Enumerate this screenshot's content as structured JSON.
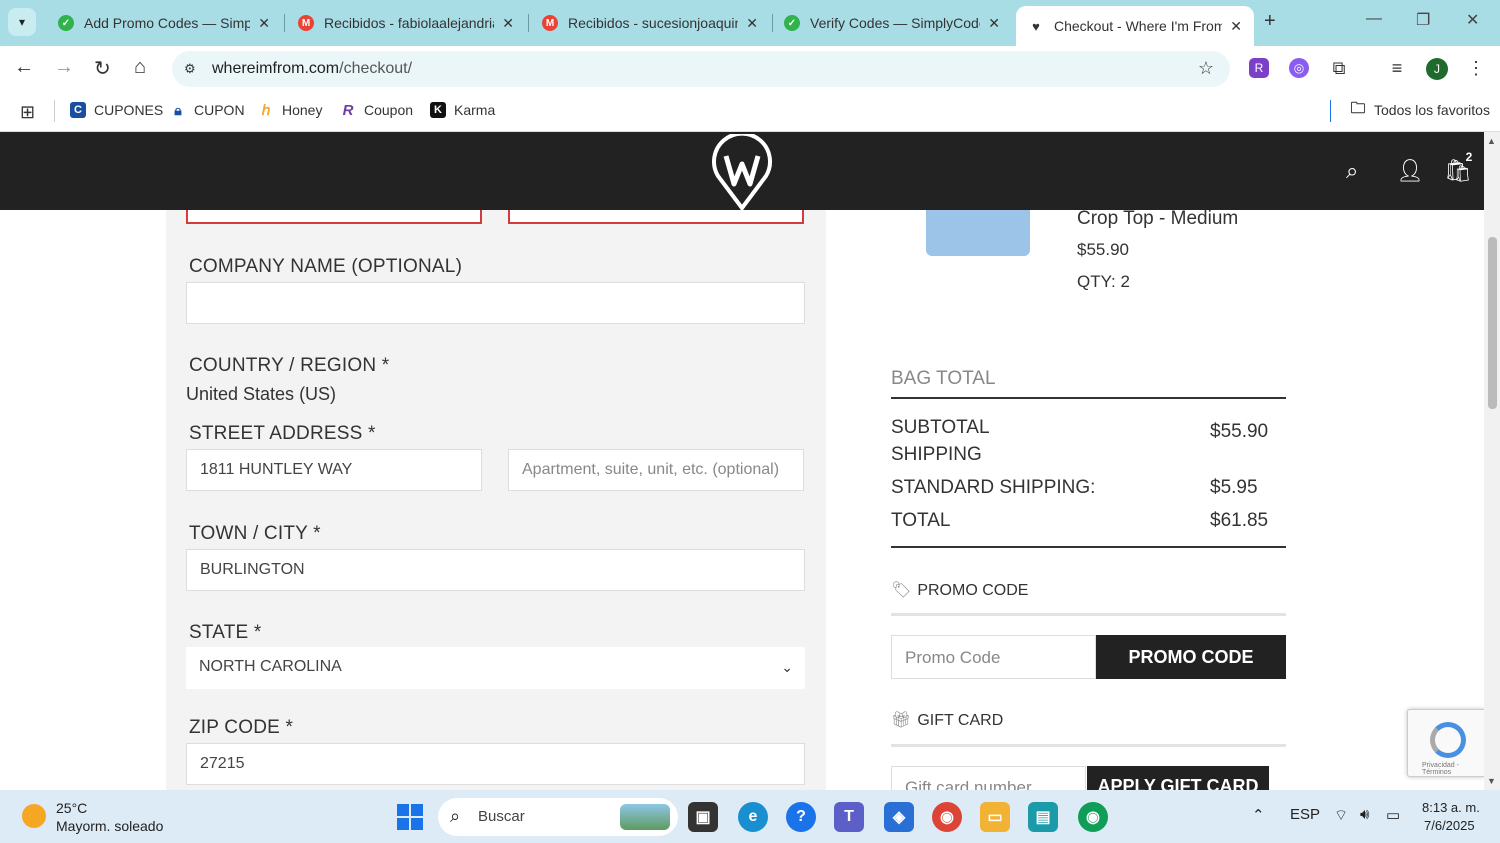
{
  "browser": {
    "tabs": [
      {
        "title": "Add Promo Codes — Simply",
        "favicon": "simplycodes-icon",
        "color": "#2fb34a"
      },
      {
        "title": "Recibidos - fabiolaalejandria",
        "favicon": "gmail-icon",
        "color": "#ea4335"
      },
      {
        "title": "Recibidos - sucesionjoaquin",
        "favicon": "gmail-icon",
        "color": "#ea4335"
      },
      {
        "title": "Verify Codes — SimplyCodes",
        "favicon": "simplycodes-icon",
        "color": "#2fb34a"
      },
      {
        "title": "Checkout - Where I'm From",
        "favicon": "whereimfrom-icon",
        "color": "#333333",
        "active": true
      }
    ],
    "url_domain": "whereimfrom.com",
    "url_path": "/checkout/",
    "bookmarks": [
      {
        "label": "CUPONES",
        "icon": "cupones-icon",
        "color": "#1a4fa0"
      },
      {
        "label": "CUPON",
        "icon": "lock-icon",
        "color": "#1a4fa0"
      },
      {
        "label": "Honey",
        "icon": "honey-icon",
        "color": "#f5a623"
      },
      {
        "label": "Coupon",
        "icon": "coupon-r-icon",
        "color": "#6a3fa0"
      },
      {
        "label": "Karma",
        "icon": "karma-icon",
        "color": "#111111"
      }
    ],
    "all_favorites": "Todos los favoritos",
    "profile_initial": "J"
  },
  "site": {
    "cart_count": "2"
  },
  "form": {
    "company_label": "COMPANY NAME (OPTIONAL)",
    "company_value": "",
    "country_label": "COUNTRY / REGION *",
    "country_value": "United States (US)",
    "street_label": "STREET ADDRESS *",
    "street_value": "1811 HUNTLEY WAY",
    "apt_placeholder": "Apartment, suite, unit, etc. (optional)",
    "city_label": "TOWN / CITY *",
    "city_value": "BURLINGTON",
    "state_label": "STATE *",
    "state_value": "NORTH CAROLINA",
    "zip_label": "ZIP CODE *",
    "zip_value": "27215"
  },
  "summary": {
    "product_name": "Crop Top - Medium",
    "product_price": "$55.90",
    "product_qty": "QTY: 2",
    "bag_total_heading": "BAG TOTAL",
    "subtotal_label": "SUBTOTAL",
    "subtotal_value": "$55.90",
    "shipping_label": "SHIPPING",
    "standard_shipping_label": "STANDARD SHIPPING:",
    "standard_shipping_value": "$5.95",
    "total_label": "TOTAL",
    "total_value": "$61.85",
    "promo_heading": "PROMO CODE",
    "promo_placeholder": "Promo Code",
    "promo_button": "PROMO CODE",
    "gift_heading": "GIFT CARD",
    "gift_placeholder": "Gift card number",
    "gift_button": "APPLY GIFT CARD",
    "recaptcha_text": "Privacidad - Términos"
  },
  "taskbar": {
    "temperature": "25°C",
    "weather": "Mayorm. soleado",
    "search_label": "Buscar",
    "language": "ESP",
    "time": "8:13 a. m.",
    "date": "7/6/2025"
  }
}
